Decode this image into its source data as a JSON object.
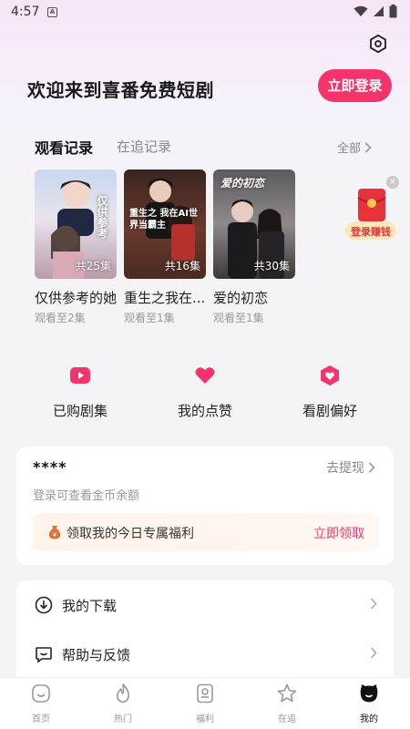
{
  "status": {
    "time": "4:57",
    "notif_letter": "A"
  },
  "header": {
    "welcome": "欢迎来到喜番免费短剧",
    "login_label": "立即登录"
  },
  "history": {
    "tab_active": "观看记录",
    "tab_inactive": "在追记录",
    "all_label": "全部",
    "items": [
      {
        "title": "仅供参考的她",
        "progress": "观看至2集",
        "episodes": "共25集",
        "poster_text": "仅供参考"
      },
      {
        "title": "重生之我在...",
        "progress": "观看至1集",
        "episodes": "共16集",
        "poster_text": "重生之 我在AI世界当霸主"
      },
      {
        "title": "爱的初恋",
        "progress": "观看至1集",
        "episodes": "共30集",
        "poster_text": "爱的初恋"
      }
    ]
  },
  "float_ad": {
    "label": "登录赚钱"
  },
  "quick_actions": [
    {
      "label": "已购剧集",
      "icon": "play-icon"
    },
    {
      "label": "我的点赞",
      "icon": "heart-icon"
    },
    {
      "label": "看剧偏好",
      "icon": "favorite-icon"
    }
  ],
  "coins": {
    "masked_balance": "****",
    "withdraw_label": "去提现",
    "hint": "登录可查看金币余额",
    "benefit_text": "领取我的今日专属福利",
    "benefit_button": "立即领取"
  },
  "menu": [
    {
      "label": "我的下载",
      "icon": "download-icon"
    },
    {
      "label": "帮助与反馈",
      "icon": "feedback-icon"
    }
  ],
  "tabbar": [
    {
      "label": "首页",
      "icon": "home-icon"
    },
    {
      "label": "热门",
      "icon": "flame-icon"
    },
    {
      "label": "福利",
      "icon": "gift-icon"
    },
    {
      "label": "在追",
      "icon": "star-icon"
    },
    {
      "label": "我的",
      "icon": "profile-icon",
      "active": true
    }
  ],
  "colors": {
    "accent": "#f4346a",
    "background_top": "#f7e6f6"
  }
}
